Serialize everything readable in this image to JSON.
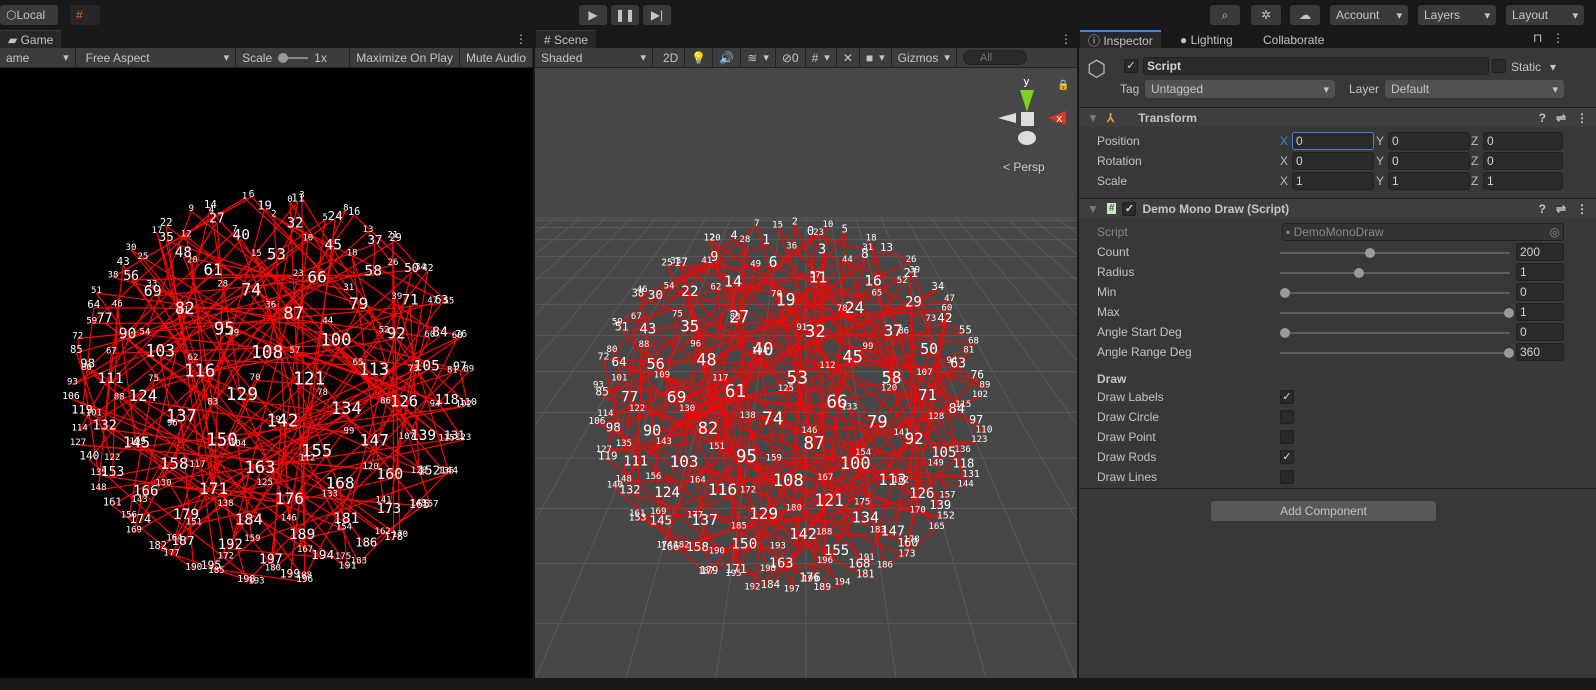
{
  "toolbar": {
    "local_label": "Local",
    "account_label": "Account",
    "layers_label": "Layers",
    "layout_label": "Layout"
  },
  "game": {
    "tab_label": "Game",
    "display_label": "ame",
    "aspect_label": "Free Aspect",
    "scale_label": "Scale",
    "scale_value": "1x",
    "maximize_label": "Maximize On Play",
    "mute_label": "Mute Audio",
    "label_count": 200
  },
  "scene": {
    "tab_label": "Scene",
    "shading_label": "Shaded",
    "mode_2d": "2D",
    "hidden_count": "0",
    "gizmos_label": "Gizmos",
    "search_placeholder": "All",
    "gizmo_y": "y",
    "gizmo_x": "x",
    "persp_label": "Persp",
    "label_count": 200
  },
  "inspector": {
    "tab_label": "Inspector",
    "lighting_tab": "Lighting",
    "collaborate_tab": "Collaborate",
    "object_name": "Script",
    "static_label": "Static",
    "tag_label": "Tag",
    "tag_value": "Untagged",
    "layer_label": "Layer",
    "layer_value": "Default",
    "transform": {
      "title": "Transform",
      "rows": [
        {
          "label": "Position",
          "x": "0",
          "y": "0",
          "z": "0"
        },
        {
          "label": "Rotation",
          "x": "0",
          "y": "0",
          "z": "0"
        },
        {
          "label": "Scale",
          "x": "1",
          "y": "1",
          "z": "1"
        }
      ],
      "axis_x": "X",
      "axis_y": "Y",
      "axis_z": "Z"
    },
    "script_component": {
      "title": "Demo Mono Draw (Script)",
      "script_label": "Script",
      "script_value": "DemoMonoDraw",
      "sliders": [
        {
          "label": "Count",
          "value": "200",
          "fraction": 0.38
        },
        {
          "label": "Radius",
          "value": "1",
          "fraction": 0.33
        },
        {
          "label": "Min",
          "value": "0",
          "fraction": 0
        },
        {
          "label": "Max",
          "value": "1",
          "fraction": 1
        },
        {
          "label": "Angle Start Deg",
          "value": "0",
          "fraction": 0
        },
        {
          "label": "Angle Range Deg",
          "value": "360",
          "fraction": 1
        }
      ],
      "draw_header": "Draw",
      "toggles": [
        {
          "label": "Draw Labels",
          "checked": true
        },
        {
          "label": "Draw Circle",
          "checked": false
        },
        {
          "label": "Draw Point",
          "checked": false
        },
        {
          "label": "Draw Rods",
          "checked": true
        },
        {
          "label": "Draw Lines",
          "checked": false
        }
      ]
    },
    "add_component": "Add Component"
  },
  "colors": {
    "rod": "#ff0000",
    "label": "#ffffff",
    "accent": "#4c7fd1"
  }
}
